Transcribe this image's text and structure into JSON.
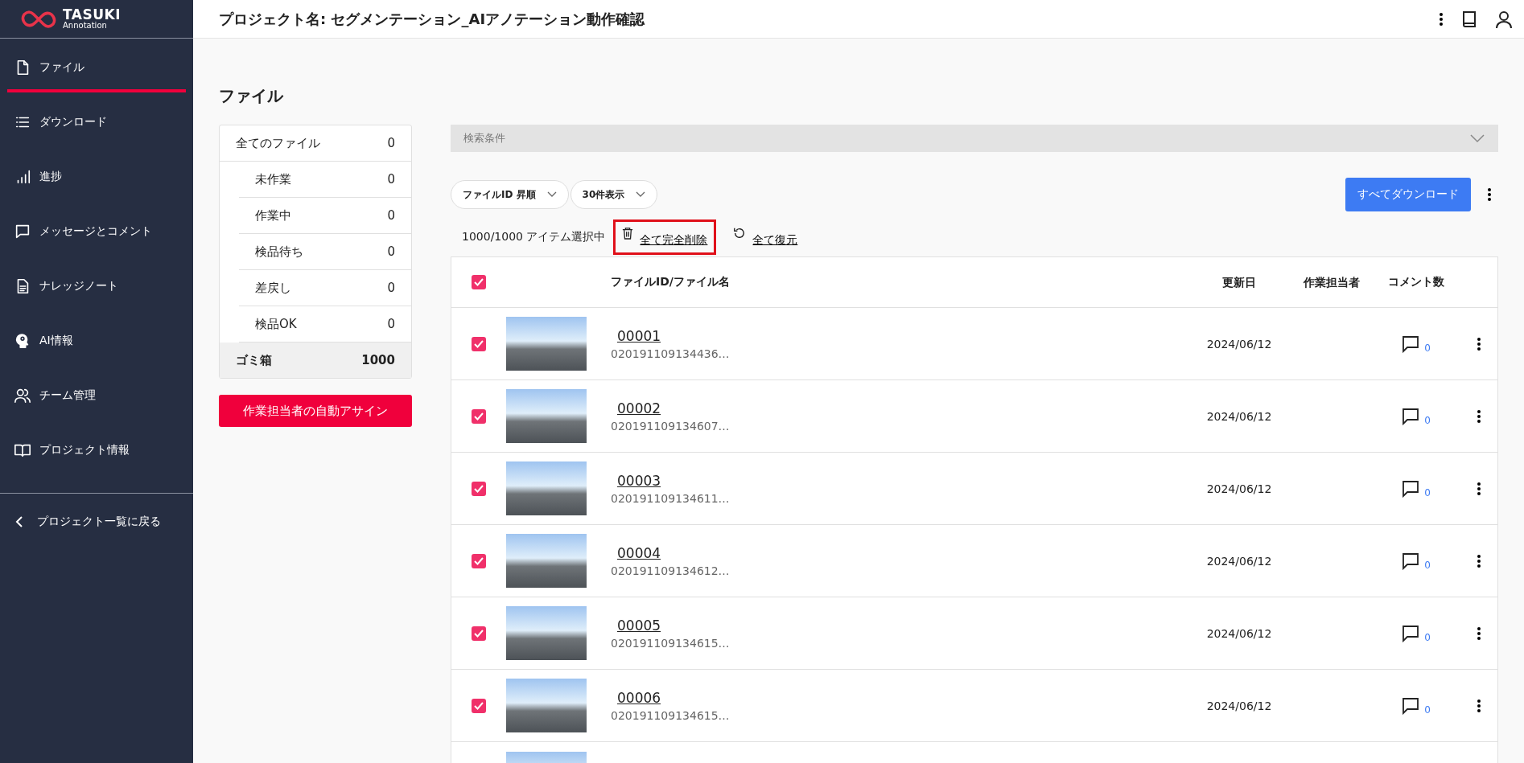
{
  "logo": {
    "name": "TASUKI",
    "subtitle": "Annotation"
  },
  "header": {
    "title": "プロジェクト名: セグメンテーション_AIアノテーション動作確認"
  },
  "sidebar": {
    "items": [
      {
        "label": "ファイル",
        "selected": true
      },
      {
        "label": "ダウンロード",
        "selected": false
      },
      {
        "label": "進捗",
        "selected": false
      },
      {
        "label": "メッセージとコメント",
        "selected": false
      },
      {
        "label": "ナレッジノート",
        "selected": false
      },
      {
        "label": "AI情報",
        "selected": false
      },
      {
        "label": "チーム管理",
        "selected": false
      },
      {
        "label": "プロジェクト情報",
        "selected": false
      }
    ],
    "back_link": "プロジェクト一覧に戻る"
  },
  "page_title": "ファイル",
  "status_filter": {
    "all": {
      "label": "全てのファイル",
      "count": "0",
      "selected": false,
      "children": [
        {
          "label": "未作業",
          "count": "0",
          "selected": false
        },
        {
          "label": "作業中",
          "count": "0",
          "selected": false
        },
        {
          "label": "検品待ち",
          "count": "0",
          "selected": false
        },
        {
          "label": "差戻し",
          "count": "0",
          "selected": false
        },
        {
          "label": "検品OK",
          "count": "0",
          "selected": false
        }
      ]
    },
    "trash": {
      "label": "ゴミ箱",
      "count": "1000",
      "selected": true
    }
  },
  "assign_button": "作業担当者の自動アサイン",
  "search_panel": {
    "label": "検索条件",
    "expanded": false
  },
  "sort_dropdown": {
    "value": "ファイルID 昇順"
  },
  "page_size_dropdown": {
    "value": "30件表示"
  },
  "download_all_button": "すべてダウンロード",
  "selection": {
    "summary": "1000/1000 アイテム選択中",
    "actions": [
      {
        "label": "全て完全削除",
        "highlighted": true
      },
      {
        "label": "全て復元",
        "highlighted": false
      }
    ]
  },
  "table": {
    "all_checked": true,
    "columns": [
      "ファイルID/ファイル名",
      "更新日",
      "作業担当者",
      "コメント数"
    ],
    "rows": [
      {
        "checked": true,
        "file_id": "00001",
        "file_name": "020191109134436…",
        "updated": "2024/06/12",
        "comments": "0"
      },
      {
        "checked": true,
        "file_id": "00002",
        "file_name": "020191109134607…",
        "updated": "2024/06/12",
        "comments": "0"
      },
      {
        "checked": true,
        "file_id": "00003",
        "file_name": "020191109134611…",
        "updated": "2024/06/12",
        "comments": "0"
      },
      {
        "checked": true,
        "file_id": "00004",
        "file_name": "020191109134612…",
        "updated": "2024/06/12",
        "comments": "0"
      },
      {
        "checked": true,
        "file_id": "00005",
        "file_name": "020191109134615…",
        "updated": "2024/06/12",
        "comments": "0"
      },
      {
        "checked": true,
        "file_id": "00006",
        "file_name": "020191109134615…",
        "updated": "2024/06/12",
        "comments": "0"
      }
    ],
    "more_rows_below": true
  }
}
